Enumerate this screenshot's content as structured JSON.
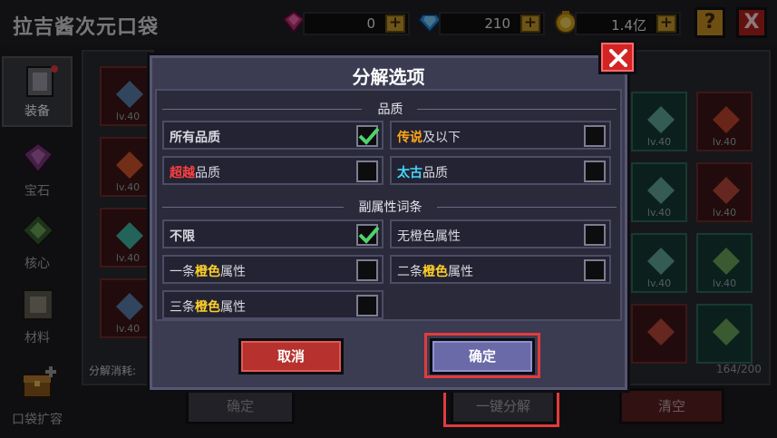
{
  "app": {
    "title": "拉吉酱次元口袋"
  },
  "resources": [
    {
      "icon": "pink-gem-icon",
      "value": "0"
    },
    {
      "icon": "blue-diamond-icon",
      "value": "210"
    },
    {
      "icon": "gold-coin-icon",
      "value": "1.4亿"
    }
  ],
  "header": {
    "help_label": "?",
    "close_label": "X"
  },
  "sidebar": {
    "items": [
      {
        "label": "装备",
        "icon": "armor-icon",
        "active": true
      },
      {
        "label": "宝石",
        "icon": "gem-icon",
        "active": false
      },
      {
        "label": "核心",
        "icon": "core-icon",
        "active": false
      },
      {
        "label": "材料",
        "icon": "material-icon",
        "active": false
      },
      {
        "label": "口袋扩容",
        "icon": "chest-icon",
        "active": false
      }
    ]
  },
  "inventory": {
    "level_label": "lv.40",
    "decompose_cost_label": "分解消耗:",
    "capacity": "164/200"
  },
  "bottom_bar": {
    "confirm_label": "确定",
    "one_key_decompose_label": "一键分解",
    "clear_label": "清空"
  },
  "dialog": {
    "title": "分解选项",
    "quality_section": {
      "label": "品质",
      "options": [
        {
          "parts": [
            "所有品质"
          ],
          "checked": true
        },
        {
          "parts": [
            "传说",
            "及以下"
          ],
          "checked": false
        },
        {
          "parts": [
            "超越",
            "品质"
          ],
          "checked": false
        },
        {
          "parts": [
            "太古",
            "品质"
          ],
          "checked": false
        }
      ]
    },
    "affix_section": {
      "label": "副属性词条",
      "options": [
        {
          "parts": [
            "不限"
          ],
          "checked": true
        },
        {
          "parts": [
            "无橙色属性"
          ],
          "checked": false
        },
        {
          "parts": [
            "一条",
            "橙色",
            "属性"
          ],
          "checked": false
        },
        {
          "parts": [
            "二条",
            "橙色",
            "属性"
          ],
          "checked": false
        },
        {
          "parts": [
            "三条",
            "橙色",
            "属性"
          ],
          "checked": false
        }
      ]
    },
    "cancel_label": "取消",
    "confirm_label": "确定"
  },
  "colors": {
    "highlight": "#e23b3b",
    "all_quality": "#3ee062",
    "legendary": "#ffa717",
    "transcend": "#ff3f3f",
    "ancient": "#43d6ff",
    "orange_affix": "#ffa717"
  }
}
